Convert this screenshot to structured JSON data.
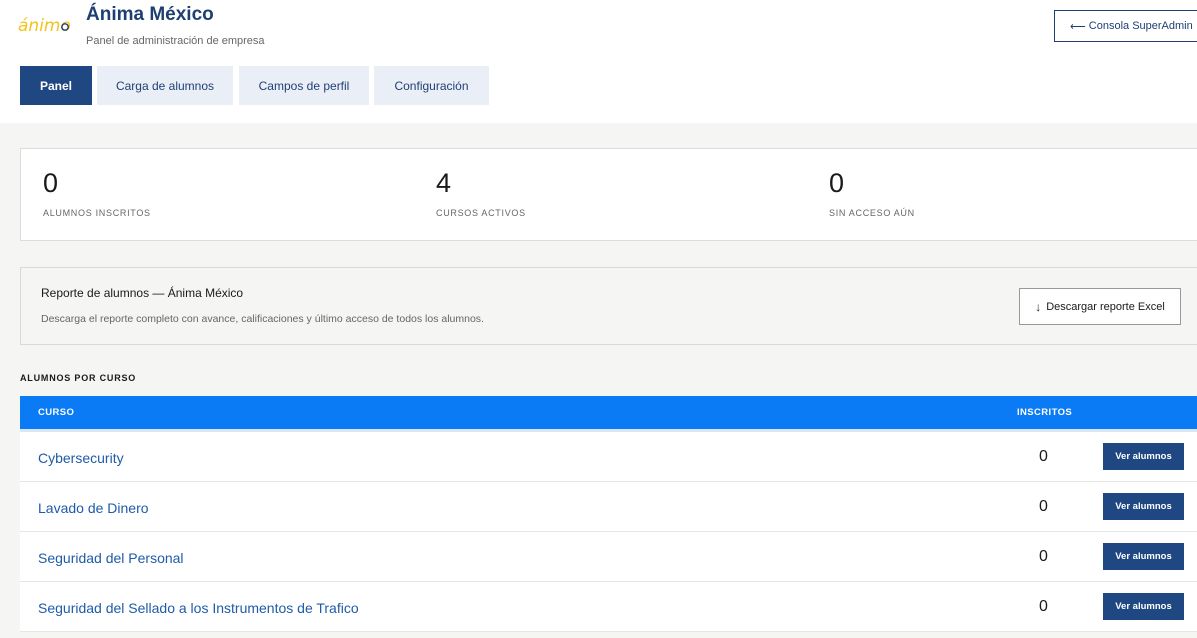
{
  "header": {
    "logo_text": "ánimo",
    "company_name": "Ánima México",
    "subtitle": "Panel de administración de empresa",
    "superadmin_label": "Consola SuperAdmin",
    "superadmin_arrow": "⟵"
  },
  "tabs": [
    {
      "label": "Panel",
      "active": true
    },
    {
      "label": "Carga de alumnos",
      "active": false
    },
    {
      "label": "Campos de perfil",
      "active": false
    },
    {
      "label": "Configuración",
      "active": false
    }
  ],
  "stats": [
    {
      "value": "0",
      "label": "ALUMNOS INSCRITOS"
    },
    {
      "value": "4",
      "label": "CURSOS ACTIVOS"
    },
    {
      "value": "0",
      "label": "SIN ACCESO AÚN"
    }
  ],
  "report": {
    "title": "Reporte de alumnos — Ánima México",
    "description": "Descarga el reporte completo con avance, calificaciones y último acceso de todos los alumnos.",
    "download_label": "Descargar reporte Excel",
    "download_icon": "↓"
  },
  "section_title": "ALUMNOS POR CURSO",
  "table": {
    "columns": [
      "CURSO",
      "INSCRITOS"
    ],
    "rows": [
      {
        "course": "Cybersecurity",
        "enrolled": "0",
        "action": "Ver alumnos"
      },
      {
        "course": "Lavado de Dinero",
        "enrolled": "0",
        "action": "Ver alumnos"
      },
      {
        "course": "Seguridad del Personal",
        "enrolled": "0",
        "action": "Ver alumnos"
      },
      {
        "course": "Seguridad del Sellado a los Instrumentos de Trafico",
        "enrolled": "0",
        "action": "Ver alumnos"
      }
    ]
  },
  "colors": {
    "brand_navy": "#1f4782",
    "header_blue": "#0a7af5",
    "link_blue": "#1f5ba8",
    "logo_yellow": "#f0c419"
  }
}
